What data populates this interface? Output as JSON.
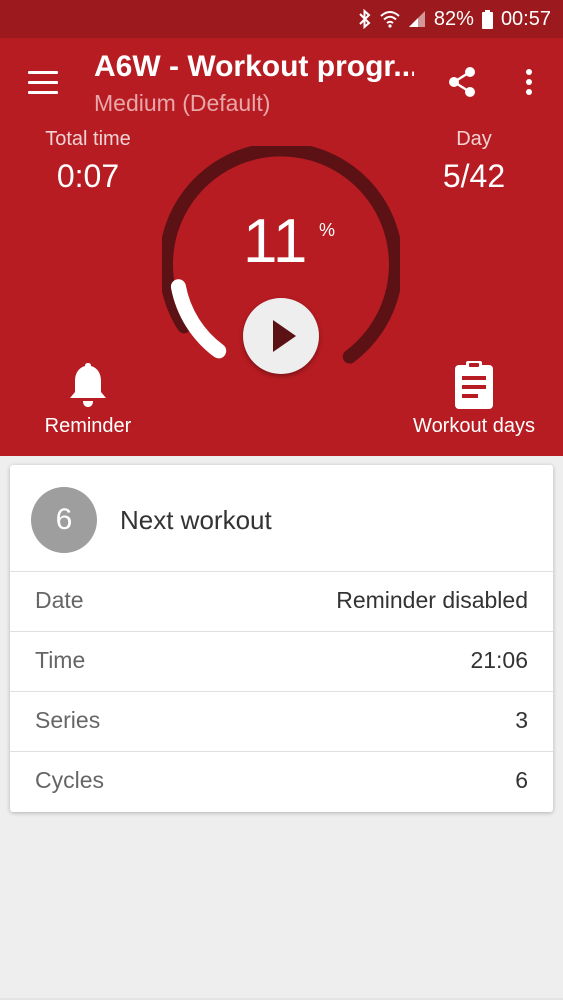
{
  "status_bar": {
    "battery": "82%",
    "time": "00:57"
  },
  "header": {
    "title": "A6W - Workout progr...",
    "subtitle": "Medium (Default)",
    "total_time_label": "Total time",
    "total_time_value": "0:07",
    "day_label": "Day",
    "day_value": "5/42",
    "progress_value": "11",
    "progress_unit": "%",
    "reminder_label": "Reminder",
    "workout_days_label": "Workout days"
  },
  "colors": {
    "header": "#b71c22",
    "statusbar": "#9c1a1e",
    "badge": "#9e9e9e"
  },
  "card": {
    "badge": "6",
    "title": "Next workout",
    "rows": [
      {
        "label": "Date",
        "value": "Reminder disabled"
      },
      {
        "label": "Time",
        "value": "21:06"
      },
      {
        "label": "Series",
        "value": "3"
      },
      {
        "label": "Cycles",
        "value": "6"
      }
    ]
  }
}
